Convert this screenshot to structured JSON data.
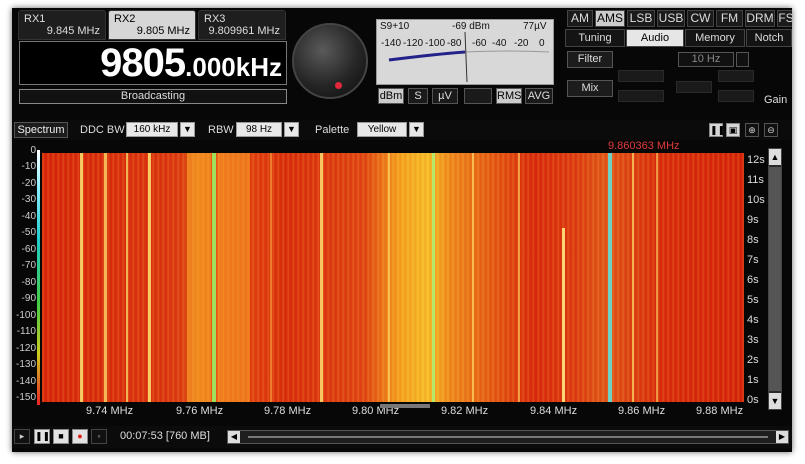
{
  "receivers": [
    {
      "name": "RX1",
      "freq": "9.845 MHz"
    },
    {
      "name": "RX2",
      "freq": "9.805 MHz"
    },
    {
      "name": "RX3",
      "freq": "9.809961 MHz"
    }
  ],
  "main_freq": {
    "mhz": "9805",
    "khz": ".000kHz"
  },
  "mode_label": "Broadcasting",
  "meter": {
    "s_label": "S9+10",
    "dbm": "-69 dBm",
    "uv": "77µV",
    "scale": [
      "-140",
      "-120",
      "-100",
      "-80",
      "-60",
      "-40",
      "-20",
      "0"
    ],
    "buttons": [
      "dBm",
      "S",
      "µV",
      "RMS",
      "AVG"
    ]
  },
  "modes": [
    "AM",
    "AMS",
    "LSB",
    "USB",
    "CW",
    "FM",
    "DRM",
    "FS"
  ],
  "panel_tabs": [
    "Tuning",
    "Audio",
    "Memory",
    "Notch"
  ],
  "audio": {
    "filter_label": "Filter",
    "filter_value": "10 Hz",
    "mix_label": "Mix",
    "gain_label": "Gain"
  },
  "toolbar": {
    "spectrum_label": "Spectrum",
    "ddc_label": "DDC BW",
    "ddc_value": "160 kHz",
    "rbw_label": "RBW",
    "rbw_value": "98 Hz",
    "palette_label": "Palette",
    "palette_value": "Yellow"
  },
  "marker_freq": "9.860363 MHz",
  "db_axis": [
    "0",
    "-10",
    "-20",
    "-30",
    "-40",
    "-50",
    "-60",
    "-70",
    "-80",
    "-90",
    "-100",
    "-110",
    "-120",
    "-130",
    "-140",
    "-150"
  ],
  "time_axis": [
    "12s",
    "11s",
    "10s",
    "9s",
    "8s",
    "7s",
    "6s",
    "5s",
    "4s",
    "3s",
    "2s",
    "1s",
    "0s"
  ],
  "freq_axis": [
    "9.74 MHz",
    "9.76 MHz",
    "9.78 MHz",
    "9.80 MHz",
    "9.82 MHz",
    "9.84 MHz",
    "9.86 MHz",
    "9.88 MHz"
  ],
  "playback": {
    "time": "00:07:53",
    "size": "[760 MB]"
  },
  "colors": {
    "accent_red": "#e23a3a",
    "meter_bg": "#d8d8d8"
  }
}
